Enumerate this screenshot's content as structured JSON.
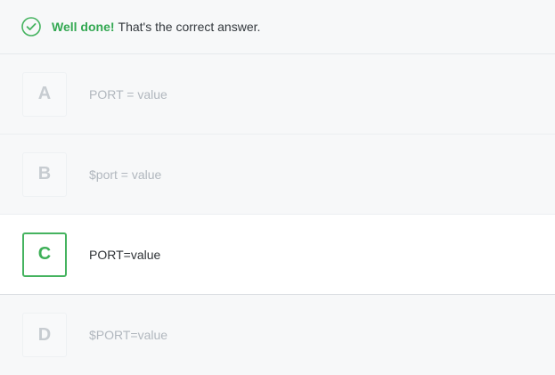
{
  "feedback": {
    "icon": "check-circle-icon",
    "strong_text": "Well done!",
    "message": "That's the correct answer."
  },
  "options": [
    {
      "letter": "A",
      "label": "PORT = value",
      "selected": false
    },
    {
      "letter": "B",
      "label": "$port = value",
      "selected": false
    },
    {
      "letter": "C",
      "label": "PORT=value",
      "selected": true
    },
    {
      "letter": "D",
      "label": "$PORT=value",
      "selected": false
    }
  ],
  "colors": {
    "success": "#45b35f",
    "page_background": "#f7f8f9",
    "selected_background": "#ffffff",
    "muted_text": "#b1b7be",
    "dark_text": "#2f3337"
  }
}
